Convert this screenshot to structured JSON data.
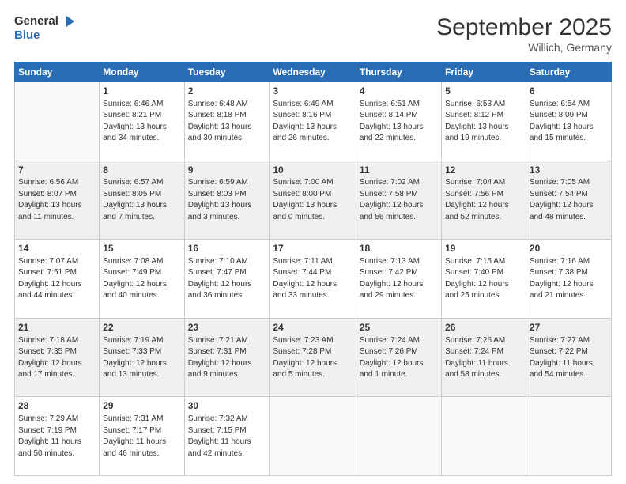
{
  "logo": {
    "general": "General",
    "blue": "Blue"
  },
  "title": "September 2025",
  "subtitle": "Willich, Germany",
  "weekdays": [
    "Sunday",
    "Monday",
    "Tuesday",
    "Wednesday",
    "Thursday",
    "Friday",
    "Saturday"
  ],
  "weeks": [
    [
      {
        "day": "",
        "detail": ""
      },
      {
        "day": "1",
        "detail": "Sunrise: 6:46 AM\nSunset: 8:21 PM\nDaylight: 13 hours\nand 34 minutes."
      },
      {
        "day": "2",
        "detail": "Sunrise: 6:48 AM\nSunset: 8:18 PM\nDaylight: 13 hours\nand 30 minutes."
      },
      {
        "day": "3",
        "detail": "Sunrise: 6:49 AM\nSunset: 8:16 PM\nDaylight: 13 hours\nand 26 minutes."
      },
      {
        "day": "4",
        "detail": "Sunrise: 6:51 AM\nSunset: 8:14 PM\nDaylight: 13 hours\nand 22 minutes."
      },
      {
        "day": "5",
        "detail": "Sunrise: 6:53 AM\nSunset: 8:12 PM\nDaylight: 13 hours\nand 19 minutes."
      },
      {
        "day": "6",
        "detail": "Sunrise: 6:54 AM\nSunset: 8:09 PM\nDaylight: 13 hours\nand 15 minutes."
      }
    ],
    [
      {
        "day": "7",
        "detail": "Sunrise: 6:56 AM\nSunset: 8:07 PM\nDaylight: 13 hours\nand 11 minutes."
      },
      {
        "day": "8",
        "detail": "Sunrise: 6:57 AM\nSunset: 8:05 PM\nDaylight: 13 hours\nand 7 minutes."
      },
      {
        "day": "9",
        "detail": "Sunrise: 6:59 AM\nSunset: 8:03 PM\nDaylight: 13 hours\nand 3 minutes."
      },
      {
        "day": "10",
        "detail": "Sunrise: 7:00 AM\nSunset: 8:00 PM\nDaylight: 13 hours\nand 0 minutes."
      },
      {
        "day": "11",
        "detail": "Sunrise: 7:02 AM\nSunset: 7:58 PM\nDaylight: 12 hours\nand 56 minutes."
      },
      {
        "day": "12",
        "detail": "Sunrise: 7:04 AM\nSunset: 7:56 PM\nDaylight: 12 hours\nand 52 minutes."
      },
      {
        "day": "13",
        "detail": "Sunrise: 7:05 AM\nSunset: 7:54 PM\nDaylight: 12 hours\nand 48 minutes."
      }
    ],
    [
      {
        "day": "14",
        "detail": "Sunrise: 7:07 AM\nSunset: 7:51 PM\nDaylight: 12 hours\nand 44 minutes."
      },
      {
        "day": "15",
        "detail": "Sunrise: 7:08 AM\nSunset: 7:49 PM\nDaylight: 12 hours\nand 40 minutes."
      },
      {
        "day": "16",
        "detail": "Sunrise: 7:10 AM\nSunset: 7:47 PM\nDaylight: 12 hours\nand 36 minutes."
      },
      {
        "day": "17",
        "detail": "Sunrise: 7:11 AM\nSunset: 7:44 PM\nDaylight: 12 hours\nand 33 minutes."
      },
      {
        "day": "18",
        "detail": "Sunrise: 7:13 AM\nSunset: 7:42 PM\nDaylight: 12 hours\nand 29 minutes."
      },
      {
        "day": "19",
        "detail": "Sunrise: 7:15 AM\nSunset: 7:40 PM\nDaylight: 12 hours\nand 25 minutes."
      },
      {
        "day": "20",
        "detail": "Sunrise: 7:16 AM\nSunset: 7:38 PM\nDaylight: 12 hours\nand 21 minutes."
      }
    ],
    [
      {
        "day": "21",
        "detail": "Sunrise: 7:18 AM\nSunset: 7:35 PM\nDaylight: 12 hours\nand 17 minutes."
      },
      {
        "day": "22",
        "detail": "Sunrise: 7:19 AM\nSunset: 7:33 PM\nDaylight: 12 hours\nand 13 minutes."
      },
      {
        "day": "23",
        "detail": "Sunrise: 7:21 AM\nSunset: 7:31 PM\nDaylight: 12 hours\nand 9 minutes."
      },
      {
        "day": "24",
        "detail": "Sunrise: 7:23 AM\nSunset: 7:28 PM\nDaylight: 12 hours\nand 5 minutes."
      },
      {
        "day": "25",
        "detail": "Sunrise: 7:24 AM\nSunset: 7:26 PM\nDaylight: 12 hours\nand 1 minute."
      },
      {
        "day": "26",
        "detail": "Sunrise: 7:26 AM\nSunset: 7:24 PM\nDaylight: 11 hours\nand 58 minutes."
      },
      {
        "day": "27",
        "detail": "Sunrise: 7:27 AM\nSunset: 7:22 PM\nDaylight: 11 hours\nand 54 minutes."
      }
    ],
    [
      {
        "day": "28",
        "detail": "Sunrise: 7:29 AM\nSunset: 7:19 PM\nDaylight: 11 hours\nand 50 minutes."
      },
      {
        "day": "29",
        "detail": "Sunrise: 7:31 AM\nSunset: 7:17 PM\nDaylight: 11 hours\nand 46 minutes."
      },
      {
        "day": "30",
        "detail": "Sunrise: 7:32 AM\nSunset: 7:15 PM\nDaylight: 11 hours\nand 42 minutes."
      },
      {
        "day": "",
        "detail": ""
      },
      {
        "day": "",
        "detail": ""
      },
      {
        "day": "",
        "detail": ""
      },
      {
        "day": "",
        "detail": ""
      }
    ]
  ]
}
